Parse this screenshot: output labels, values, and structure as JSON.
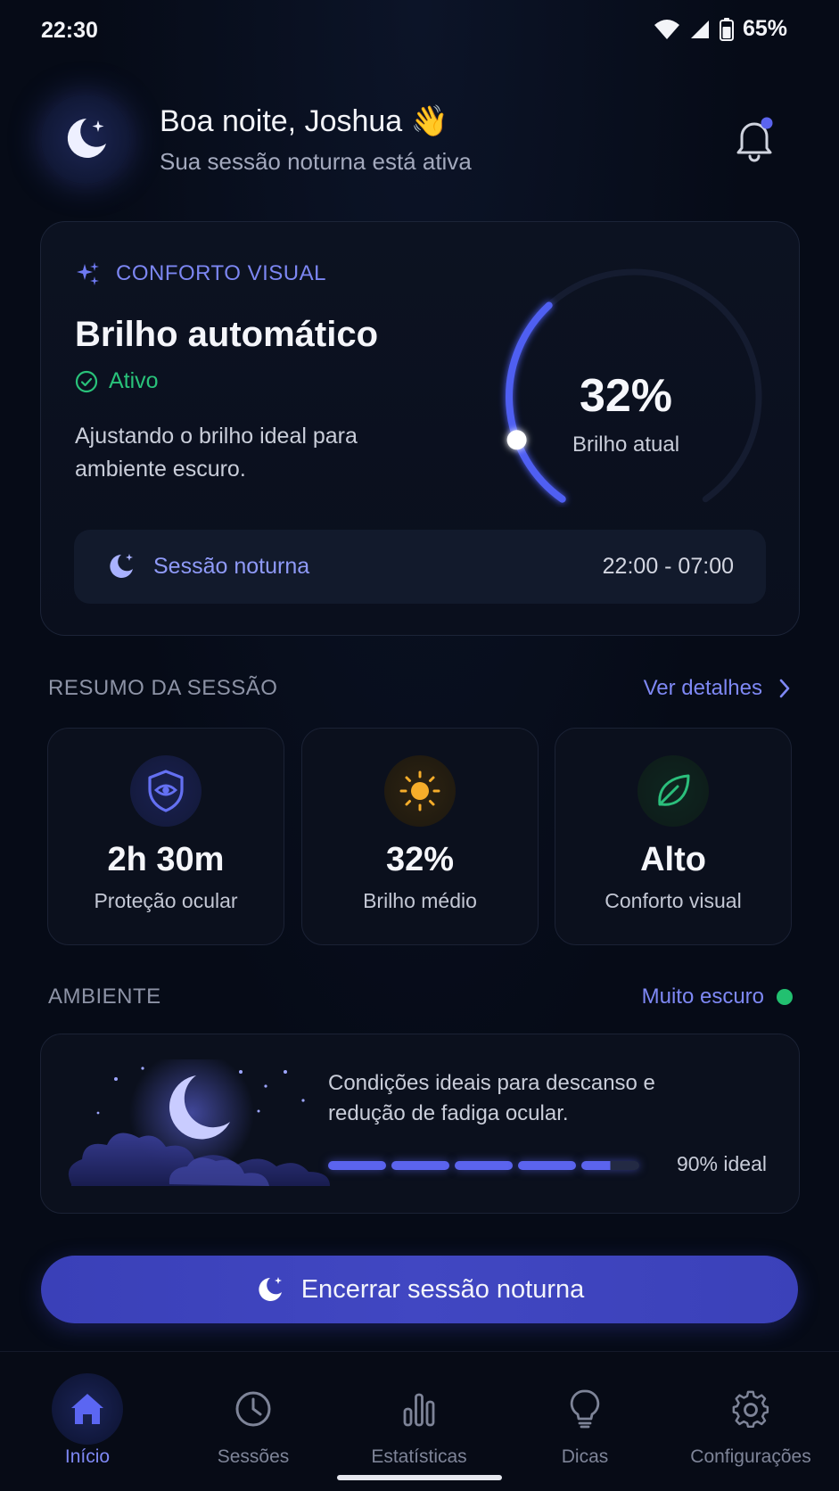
{
  "status_bar": {
    "time": "22:30",
    "battery": "65%"
  },
  "header": {
    "greeting": "Boa noite, Joshua 👋",
    "subtitle": "Sua sessão noturna está ativa"
  },
  "comfort_card": {
    "section_label": "CONFORTO VISUAL",
    "title": "Brilho automático",
    "status": "Ativo",
    "description": "Ajustando o brilho ideal para ambiente escuro.",
    "gauge_value": "32%",
    "gauge_level": 0.32,
    "gauge_caption": "Brilho atual",
    "night_session_label": "Sessão noturna",
    "night_session_time": "22:00 - 07:00"
  },
  "summary": {
    "title": "RESUMO DA SESSÃO",
    "link": "Ver detalhes",
    "stats": [
      {
        "value": "2h 30m",
        "label": "Proteção ocular",
        "icon": "shield-eye-icon",
        "color": "#5f6bf0"
      },
      {
        "value": "32%",
        "label": "Brilho médio",
        "icon": "sun-icon",
        "color": "#f6ad2a"
      },
      {
        "value": "Alto",
        "label": "Conforto visual",
        "icon": "leaf-icon",
        "color": "#2bbf7c"
      }
    ]
  },
  "ambient": {
    "title": "AMBIENTE",
    "status": "Muito escuro",
    "status_color": "#22c070",
    "description": "Condições ideais para descanso e redução de fadiga ocular.",
    "progress": 0.9,
    "progress_label": "90% ideal"
  },
  "cta": {
    "label": "Encerrar sessão noturna"
  },
  "nav": [
    {
      "label": "Início",
      "icon": "home-icon",
      "active": true
    },
    {
      "label": "Sessões",
      "icon": "clock-icon",
      "active": false
    },
    {
      "label": "Estatísticas",
      "icon": "bar-chart-icon",
      "active": false
    },
    {
      "label": "Dicas",
      "icon": "lightbulb-icon",
      "active": false
    },
    {
      "label": "Configurações",
      "icon": "gear-icon",
      "active": false
    }
  ],
  "colors": {
    "accent": "#5b64ee",
    "background": "#060b17",
    "success": "#29c27a"
  }
}
